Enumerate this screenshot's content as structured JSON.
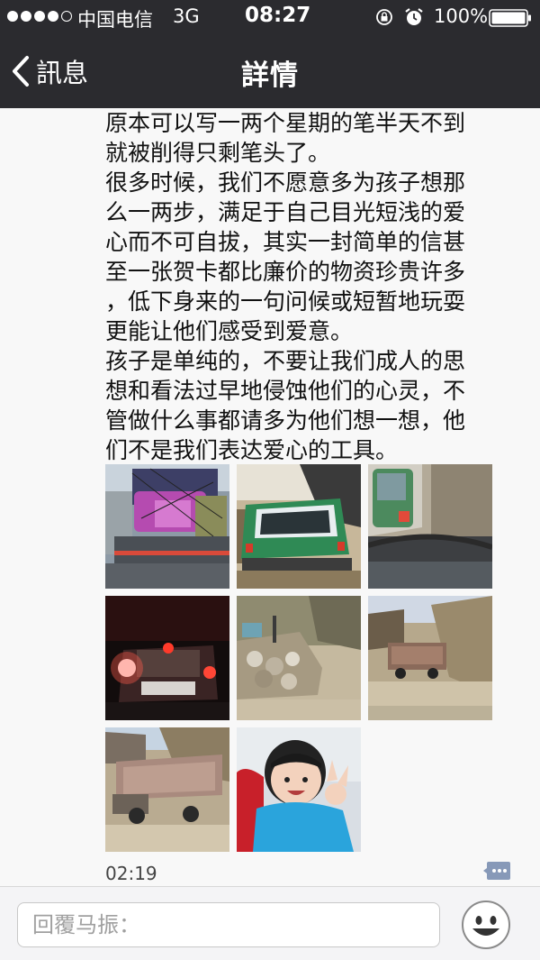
{
  "status_bar": {
    "carrier": "中国电信",
    "network": "3G",
    "time": "08:27",
    "battery": "100%"
  },
  "nav": {
    "back_label": "訊息",
    "title": "詳情"
  },
  "post": {
    "paragraphs": [
      {
        "lines": [
          "原本可以写一两个星期的笔半天不到",
          "就被削得只剩笔头了。"
        ]
      },
      {
        "lines": [
          "很多时候，我们不愿意多为孩子想那",
          "么一两步，满足于自己目光短浅的爱",
          "心而不可自拔，其实一封简单的信甚",
          "至一张贺卡都比廉价的物资珍贵许多",
          "，低下身来的一句问候或短暂地玩耍",
          "更能让他们感受到爱意。"
        ]
      },
      {
        "lines": [
          "孩子是单纯的，不要让我们成人的思",
          "想和看法过早地侵蚀他们的心灵，不",
          "管做什么事都请多为他们想一想，他",
          "们不是我们表达爱心的工具。"
        ]
      }
    ],
    "timestamp": "02:19"
  },
  "photos": [
    {
      "icon": "truck-loaded-cargo-photo"
    },
    {
      "icon": "green-van-photo"
    },
    {
      "icon": "car-taillights-road-photo"
    },
    {
      "icon": "night-car-lights-photo"
    },
    {
      "icon": "rock-rubble-photo"
    },
    {
      "icon": "truck-dirt-road-photo"
    },
    {
      "icon": "dump-truck-photo"
    },
    {
      "icon": "child-peace-sign-photo"
    }
  ],
  "reply": {
    "placeholder": "回覆马振："
  },
  "colors": {
    "bar_bg": "#2b2b2f",
    "content_bg": "#f8f8f8",
    "text": "#111111"
  }
}
